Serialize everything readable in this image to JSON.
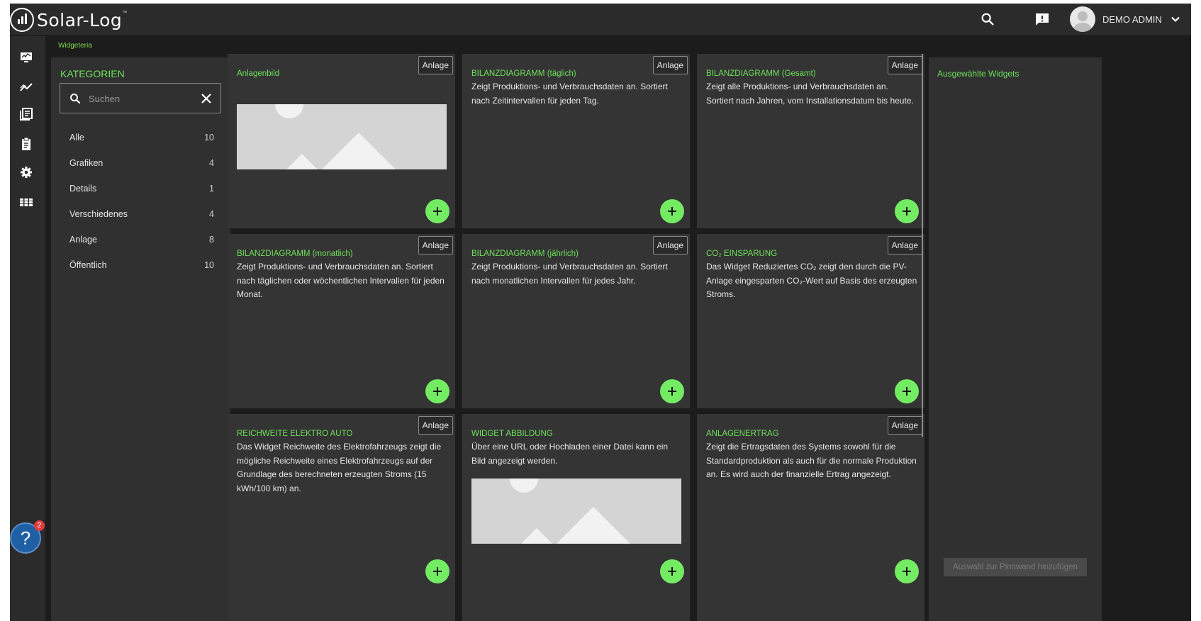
{
  "header": {
    "logo_text": "Solar-Log",
    "logo_tm": "™",
    "user_name": "DEMO ADMIN"
  },
  "breadcrumb": "Widgeteria",
  "nav_icons": [
    "monitor-icon",
    "analytics-icon",
    "reports-icon",
    "clipboard-icon",
    "settings-icon",
    "apps-grid-icon"
  ],
  "categories": {
    "title": "KATEGORIEN",
    "search_placeholder": "Suchen",
    "items": [
      {
        "label": "Alle",
        "count": "10"
      },
      {
        "label": "Grafiken",
        "count": "4"
      },
      {
        "label": "Details",
        "count": "1"
      },
      {
        "label": "Verschiedenes",
        "count": "4"
      },
      {
        "label": "Anlage",
        "count": "8"
      },
      {
        "label": "Öffentlich",
        "count": "10"
      }
    ]
  },
  "widgets": [
    {
      "title": "Anlagenbild",
      "badge": "Anlage",
      "desc": ""
    },
    {
      "title": "BILANZDIAGRAMM (täglich)",
      "badge": "Anlage",
      "desc": "Zeigt Produktions- und Verbrauchsdaten an. Sortiert nach Zeitintervallen für jeden Tag."
    },
    {
      "title": "BILANZDIAGRAMM (Gesamt)",
      "badge": "Anlage",
      "desc": "Zeigt alle Produktions- und Verbrauchsdaten an. Sortiert nach Jahren, vom Installationsdatum bis heute."
    },
    {
      "title": "BILANZDIAGRAMM (monatlich)",
      "badge": "Anlage",
      "desc": "Zeigt Produktions- und Verbrauchsdaten an. Sortiert nach täglichen oder wöchentlichen Intervallen für jeden Monat."
    },
    {
      "title": "BILANZDIAGRAMM (jährlich)",
      "badge": "Anlage",
      "desc": "Zeigt Produktions- und Verbrauchsdaten an. Sortiert nach monatlichen Intervallen für jedes Jahr."
    },
    {
      "title": "CO₂ EINSPARUNG",
      "badge": "Anlage",
      "desc": "Das Widget Reduziertes CO₂ zeigt den durch die PV-Anlage eingesparten CO₂-Wert auf Basis des erzeugten Stroms."
    },
    {
      "title": "REICHWEITE ELEKTRO AUTO",
      "badge": "Anlage",
      "desc": "Das Widget Reichweite des Elektrofahrzeugs zeigt die mögliche Reichweite eines Elektrofahrzeugs auf der Grundlage des berechneten erzeugten Stroms (15 kWh/100 km) an."
    },
    {
      "title": "WIDGET ABBILDUNG",
      "badge": "",
      "desc": "Über eine URL oder Hochladen einer Datei kann ein Bild angezeigt werden."
    },
    {
      "title": "ANLAGENERTRAG",
      "badge": "Anlage",
      "desc": "Zeigt die Ertragsdaten des Systems sowohl für die Standardproduktion als auch für die normale Produktion an. Es wird auch der finanzielle Ertrag angezeigt."
    }
  ],
  "selected": {
    "title": "Ausgewählte Widgets",
    "button_label": "Auswahl zur Pinnwand hinzufügen"
  },
  "help": {
    "glyph": "?",
    "badge_count": "2"
  },
  "colors": {
    "accent_green": "#6ee05a",
    "add_button": "#73ec63",
    "background": "#1c1c1c",
    "panel": "#303030",
    "card": "#343434"
  }
}
